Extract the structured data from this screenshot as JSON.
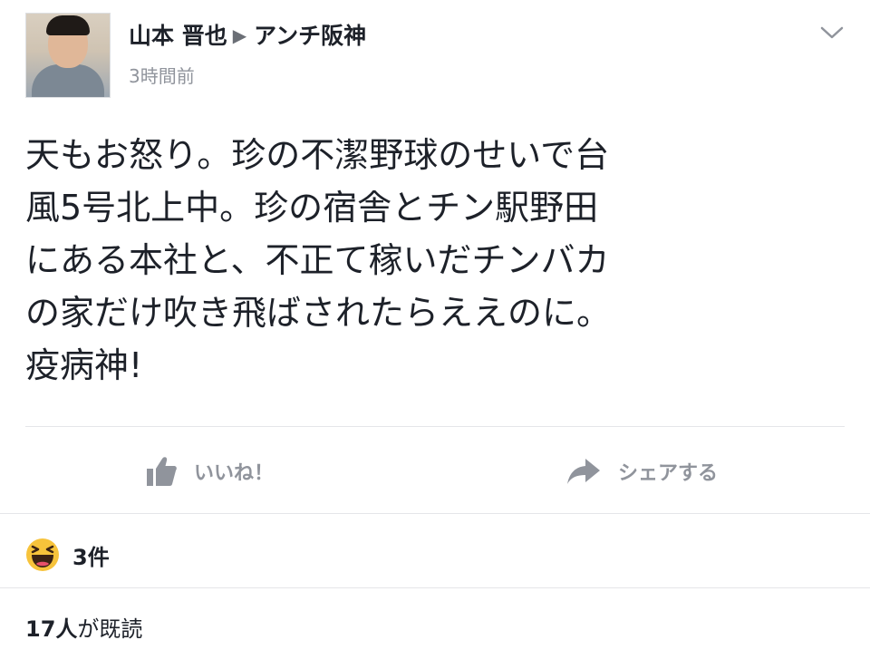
{
  "post": {
    "author": "山本 晋也",
    "target_group": "アンチ阪神",
    "timestamp": "3時間前",
    "body": "天もお怒り。珍の不潔野球のせいで台\n風5号北上中。珍の宿舎とチン駅野田\nにある本社と、不正て稼いだチンバカ\nの家だけ吹き飛ばされたらええのに。\n疫病神!"
  },
  "actions": {
    "like_label": "いいね！",
    "share_label": "シェアする"
  },
  "reactions": {
    "icon": "haha-emoji-icon",
    "count": "3件"
  },
  "seen": {
    "count": "17人",
    "suffix": "が既読"
  },
  "colors": {
    "text": "#1d2129",
    "secondary": "#90949c",
    "divider": "#e5e6e9",
    "haha_yellow": "#f7c33b"
  }
}
